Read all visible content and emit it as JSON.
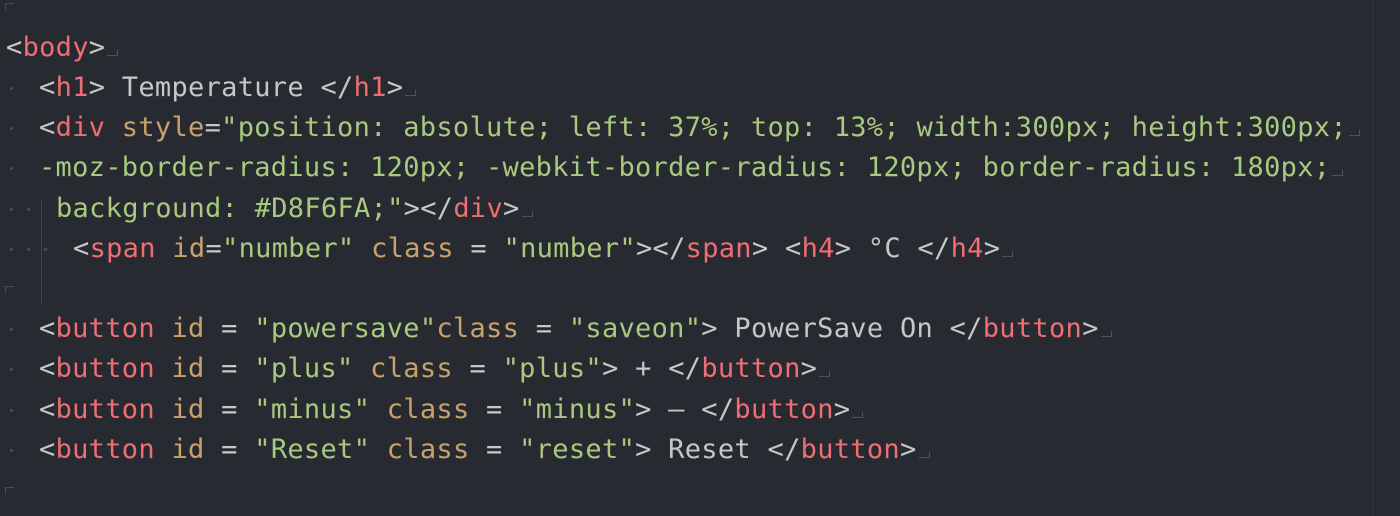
{
  "editor": {
    "language": "HTML",
    "colors": {
      "background": "#272a31",
      "tag": "#ee6e73",
      "attribute": "#c9a26b",
      "string": "#a8c97f",
      "text": "#c5c8c6"
    },
    "lines": [
      [],
      [
        {
          "t": "punct",
          "v": "<"
        },
        {
          "t": "tag",
          "v": "body"
        },
        {
          "t": "punct",
          "v": ">"
        }
      ],
      [
        {
          "t": "punct",
          "v": "<"
        },
        {
          "t": "tag",
          "v": "h1"
        },
        {
          "t": "punct",
          "v": ">"
        },
        {
          "t": "text",
          "v": " Temperature "
        },
        {
          "t": "punct",
          "v": "</"
        },
        {
          "t": "tag",
          "v": "h1"
        },
        {
          "t": "punct",
          "v": ">"
        }
      ],
      [
        {
          "t": "punct",
          "v": "<"
        },
        {
          "t": "tag",
          "v": "div"
        },
        {
          "t": "text",
          "v": " "
        },
        {
          "t": "attr",
          "v": "style"
        },
        {
          "t": "punct",
          "v": "="
        },
        {
          "t": "str",
          "v": "\"position: absolute; left: 37%; top: 13%; width:300px; height:300px;"
        }
      ],
      [
        {
          "t": "str",
          "v": "-moz-border-radius: 120px; -webkit-border-radius: 120px; border-radius: 180px;"
        }
      ],
      [
        {
          "t": "str",
          "v": "background: #D8F6FA;\""
        },
        {
          "t": "punct",
          "v": "></"
        },
        {
          "t": "tag",
          "v": "div"
        },
        {
          "t": "punct",
          "v": ">"
        }
      ],
      [
        {
          "t": "punct",
          "v": "<"
        },
        {
          "t": "tag",
          "v": "span"
        },
        {
          "t": "text",
          "v": " "
        },
        {
          "t": "attr",
          "v": "id"
        },
        {
          "t": "punct",
          "v": "="
        },
        {
          "t": "str",
          "v": "\"number\""
        },
        {
          "t": "text",
          "v": " "
        },
        {
          "t": "attr",
          "v": "class"
        },
        {
          "t": "punct",
          "v": " = "
        },
        {
          "t": "str",
          "v": "\"number\""
        },
        {
          "t": "punct",
          "v": "></"
        },
        {
          "t": "tag",
          "v": "span"
        },
        {
          "t": "punct",
          "v": ">"
        },
        {
          "t": "text",
          "v": " "
        },
        {
          "t": "punct",
          "v": "<"
        },
        {
          "t": "tag",
          "v": "h4"
        },
        {
          "t": "punct",
          "v": ">"
        },
        {
          "t": "text",
          "v": " °C "
        },
        {
          "t": "punct",
          "v": "</"
        },
        {
          "t": "tag",
          "v": "h4"
        },
        {
          "t": "punct",
          "v": ">"
        }
      ],
      [],
      [
        {
          "t": "punct",
          "v": "<"
        },
        {
          "t": "tag",
          "v": "button"
        },
        {
          "t": "text",
          "v": " "
        },
        {
          "t": "attr",
          "v": "id"
        },
        {
          "t": "punct",
          "v": " = "
        },
        {
          "t": "str",
          "v": "\"powersave\""
        },
        {
          "t": "attr",
          "v": "class"
        },
        {
          "t": "punct",
          "v": " = "
        },
        {
          "t": "str",
          "v": "\"saveon\""
        },
        {
          "t": "punct",
          "v": ">"
        },
        {
          "t": "text",
          "v": " PowerSave On "
        },
        {
          "t": "punct",
          "v": "</"
        },
        {
          "t": "tag",
          "v": "button"
        },
        {
          "t": "punct",
          "v": ">"
        }
      ],
      [
        {
          "t": "punct",
          "v": "<"
        },
        {
          "t": "tag",
          "v": "button"
        },
        {
          "t": "text",
          "v": " "
        },
        {
          "t": "attr",
          "v": "id"
        },
        {
          "t": "punct",
          "v": " = "
        },
        {
          "t": "str",
          "v": "\"plus\""
        },
        {
          "t": "text",
          "v": " "
        },
        {
          "t": "attr",
          "v": "class"
        },
        {
          "t": "punct",
          "v": " = "
        },
        {
          "t": "str",
          "v": "\"plus\""
        },
        {
          "t": "punct",
          "v": ">"
        },
        {
          "t": "text",
          "v": " + "
        },
        {
          "t": "punct",
          "v": "</"
        },
        {
          "t": "tag",
          "v": "button"
        },
        {
          "t": "punct",
          "v": ">"
        }
      ],
      [
        {
          "t": "punct",
          "v": "<"
        },
        {
          "t": "tag",
          "v": "button"
        },
        {
          "t": "text",
          "v": " "
        },
        {
          "t": "attr",
          "v": "id"
        },
        {
          "t": "punct",
          "v": " = "
        },
        {
          "t": "str",
          "v": "\"minus\""
        },
        {
          "t": "text",
          "v": " "
        },
        {
          "t": "attr",
          "v": "class"
        },
        {
          "t": "punct",
          "v": " = "
        },
        {
          "t": "str",
          "v": "\"minus\""
        },
        {
          "t": "punct",
          "v": ">"
        },
        {
          "t": "text",
          "v": " – "
        },
        {
          "t": "punct",
          "v": "</"
        },
        {
          "t": "tag",
          "v": "button"
        },
        {
          "t": "punct",
          "v": ">"
        }
      ],
      [
        {
          "t": "punct",
          "v": "<"
        },
        {
          "t": "tag",
          "v": "button"
        },
        {
          "t": "text",
          "v": " "
        },
        {
          "t": "attr",
          "v": "id"
        },
        {
          "t": "punct",
          "v": " = "
        },
        {
          "t": "str",
          "v": "\"Reset\""
        },
        {
          "t": "text",
          "v": " "
        },
        {
          "t": "attr",
          "v": "class"
        },
        {
          "t": "punct",
          "v": " = "
        },
        {
          "t": "str",
          "v": "\"reset\""
        },
        {
          "t": "punct",
          "v": ">"
        },
        {
          "t": "text",
          "v": " Reset "
        },
        {
          "t": "punct",
          "v": "</"
        },
        {
          "t": "tag",
          "v": "button"
        },
        {
          "t": "punct",
          "v": ">"
        }
      ],
      []
    ]
  }
}
